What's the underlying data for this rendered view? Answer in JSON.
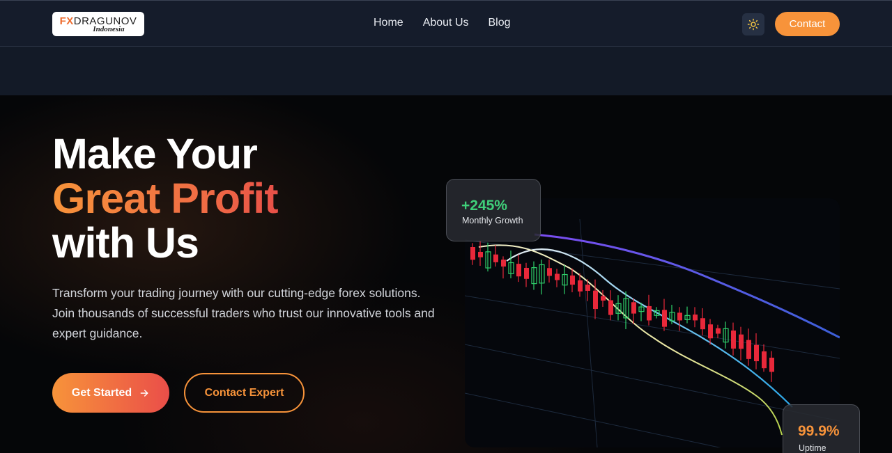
{
  "brand": {
    "logo_prefix": "FX",
    "logo_name": "DRAGUNOV",
    "logo_sub": "Indonesia"
  },
  "nav": {
    "links": [
      "Home",
      "About Us",
      "Blog"
    ],
    "theme_icon": "sun-icon",
    "contact_label": "Contact"
  },
  "hero": {
    "headline_line1": "Make Your",
    "headline_accent": "Great Profit",
    "headline_line3": "with Us",
    "description": "Transform your trading journey with our cutting-edge forex solutions. Join thousands of successful traders who trust our innovative tools and expert guidance.",
    "primary_cta": "Get Started",
    "primary_cta_icon": "arrow-right-icon",
    "secondary_cta": "Contact Expert"
  },
  "stats": {
    "growth_value": "+245%",
    "growth_label": "Monthly Growth",
    "uptime_value": "99.9%",
    "uptime_label": "Uptime"
  },
  "colors": {
    "accent": "#f7933a",
    "accent_red": "#ea4e49",
    "growth_green": "#3fd07a",
    "candle_up": "#2fd06b",
    "candle_down": "#e8283a"
  }
}
